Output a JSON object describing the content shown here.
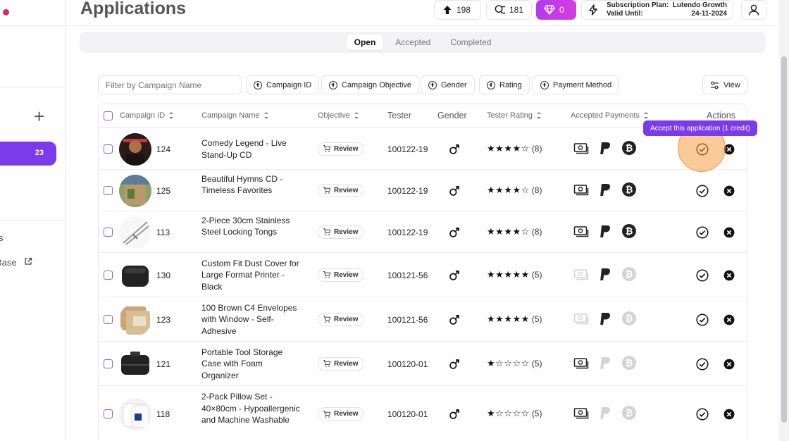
{
  "sidebar": {
    "active_badge": "23",
    "partial_item_1": "s",
    "partial_item_2": "Base"
  },
  "header": {
    "title": "Applications",
    "uploads_count": "198",
    "coins_count": "181",
    "gems_count": "0",
    "subscription_plan_label": "Subscription Plan:",
    "subscription_plan_value": "Lutendo Growth",
    "valid_until_label": "Valid Until:",
    "valid_until_value": "24-11-2024"
  },
  "tabs": [
    "Open",
    "Accepted",
    "Completed"
  ],
  "filters": {
    "search_placeholder": "Filter by Campaign Name",
    "buttons": [
      "Campaign ID",
      "Campaign Objective",
      "Gender",
      "Rating",
      "Payment Method"
    ],
    "view_label": "View"
  },
  "table": {
    "headers": {
      "campaign_id": "Campaign ID",
      "campaign_name": "Campaign Name",
      "objective": "Objective",
      "tester": "Tester",
      "gender": "Gender",
      "tester_rating": "Tester Rating",
      "accepted_payments": "Accepted Payments",
      "actions": "Actions"
    },
    "rows": [
      {
        "id": "124",
        "name": "Comedy Legend - Live Stand-Up CD",
        "objective": "Review",
        "tester": "100122-19",
        "rating": 4,
        "rating_count": "(8)",
        "payments": {
          "cash": true,
          "paypal": true,
          "bitcoin": true
        }
      },
      {
        "id": "125",
        "name": "Beautiful Hymns CD - Timeless Favorites",
        "objective": "Review",
        "tester": "100122-19",
        "rating": 4,
        "rating_count": "(8)",
        "payments": {
          "cash": true,
          "paypal": true,
          "bitcoin": true
        }
      },
      {
        "id": "113",
        "name": "2-Piece 30cm Stainless Steel Locking Tongs",
        "objective": "Review",
        "tester": "100122-19",
        "rating": 4,
        "rating_count": "(8)",
        "payments": {
          "cash": true,
          "paypal": true,
          "bitcoin": true
        }
      },
      {
        "id": "130",
        "name": "Custom Fit Dust Cover for Large Format Printer - Black",
        "objective": "Review",
        "tester": "100121-56",
        "rating": 5,
        "rating_count": "(5)",
        "payments": {
          "cash": false,
          "paypal": true,
          "bitcoin": false
        }
      },
      {
        "id": "123",
        "name": "100 Brown C4 Envelopes with Window - Self-Adhesive",
        "objective": "Review",
        "tester": "100121-56",
        "rating": 5,
        "rating_count": "(5)",
        "payments": {
          "cash": false,
          "paypal": true,
          "bitcoin": false
        }
      },
      {
        "id": "121",
        "name": "Portable Tool Storage Case with Foam Organizer",
        "objective": "Review",
        "tester": "100120-01",
        "rating": 1,
        "rating_count": "(5)",
        "payments": {
          "cash": true,
          "paypal": false,
          "bitcoin": false
        }
      },
      {
        "id": "118",
        "name": "2-Pack Pillow Set - 40×80cm - Hypoallergenic and Machine Washable",
        "objective": "Review",
        "tester": "100120-01",
        "rating": 1,
        "rating_count": "(5)",
        "payments": {
          "cash": true,
          "paypal": false,
          "bitcoin": false
        }
      }
    ]
  },
  "tooltip": "Accept this application (1 credit)",
  "colors": {
    "accent": "#7c3aed",
    "gems_gradient_start": "#b03cf0",
    "gems_gradient_end": "#d63be0",
    "disabled_icon": "#d4d4d8"
  }
}
